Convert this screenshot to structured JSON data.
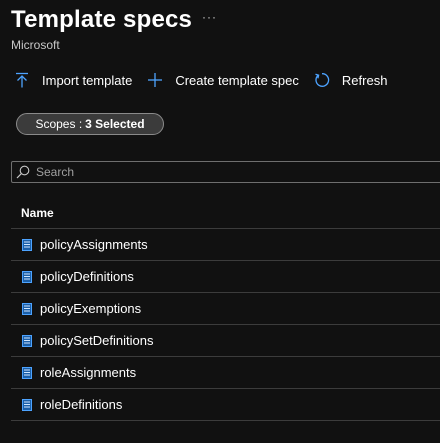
{
  "header": {
    "title": "Template specs",
    "more": "···",
    "subtitle": "Microsoft"
  },
  "toolbar": {
    "import_label": "Import template",
    "create_label": "Create template spec",
    "refresh_label": "Refresh",
    "accent_color": "#4da3ff"
  },
  "scope": {
    "prefix": "Scopes :",
    "value": "3 Selected"
  },
  "search": {
    "placeholder": "Search",
    "value": ""
  },
  "table": {
    "header": "Name",
    "rows": [
      {
        "name": "policyAssignments",
        "icon": "template-spec-icon"
      },
      {
        "name": "policyDefinitions",
        "icon": "template-spec-icon"
      },
      {
        "name": "policyExemptions",
        "icon": "template-spec-icon"
      },
      {
        "name": "policySetDefinitions",
        "icon": "template-spec-icon"
      },
      {
        "name": "roleAssignments",
        "icon": "template-spec-icon"
      },
      {
        "name": "roleDefinitions",
        "icon": "template-spec-icon"
      }
    ]
  }
}
